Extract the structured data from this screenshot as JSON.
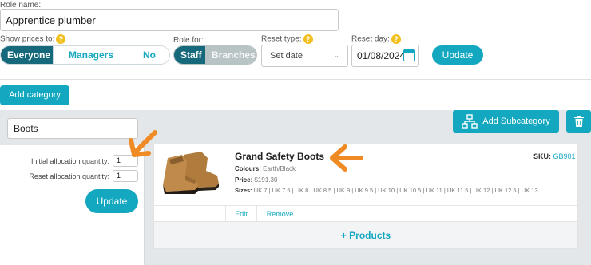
{
  "role": {
    "label": "Role name:",
    "value": "Apprentice plumber"
  },
  "show_prices": {
    "label": "Show prices to:",
    "help": "?",
    "options": [
      "Everyone",
      "Managers only",
      "No one"
    ],
    "selected": "Everyone"
  },
  "role_for": {
    "label": "Role for:",
    "options": [
      "Staff",
      "Branches"
    ],
    "selected": "Staff"
  },
  "reset_type": {
    "label": "Reset type:",
    "help": "?",
    "value": "Set date"
  },
  "reset_day": {
    "label": "Reset day:",
    "help": "?",
    "value": "01/08/2024"
  },
  "top_update_label": "Update",
  "add_category_label": "Add category",
  "category": {
    "name": "Boots",
    "initial_label": "Initial allocation quantity:",
    "initial_value": "1",
    "reset_label": "Reset allocation quantity:",
    "reset_value": "1",
    "update_label": "Update"
  },
  "add_subcategory_label": "Add Subcategory",
  "product": {
    "name": "Grand Safety Boots",
    "sku_label": "SKU:",
    "sku_value": "GB901",
    "colours_label": "Colours:",
    "colours_value": "Earth/Black",
    "price_label": "Price:",
    "price_value": "$191.30",
    "sizes_label": "Sizes:",
    "sizes_value": "UK 7 | UK 7.5 | UK 8 | UK 8.5 | UK 9 | UK 9.5 | UK 10 | UK 10.5 | UK 11 | UK 11.5 | UK 12 | UK 12.5 | UK 13",
    "edit_label": "Edit",
    "remove_label": "Remove"
  },
  "add_products_label": "+ Products",
  "colors": {
    "teal": "#14a8c0",
    "dark_teal": "#16697a",
    "arrow": "#f08a24",
    "help": "#f2c01e",
    "panel": "#e4e7e9"
  }
}
